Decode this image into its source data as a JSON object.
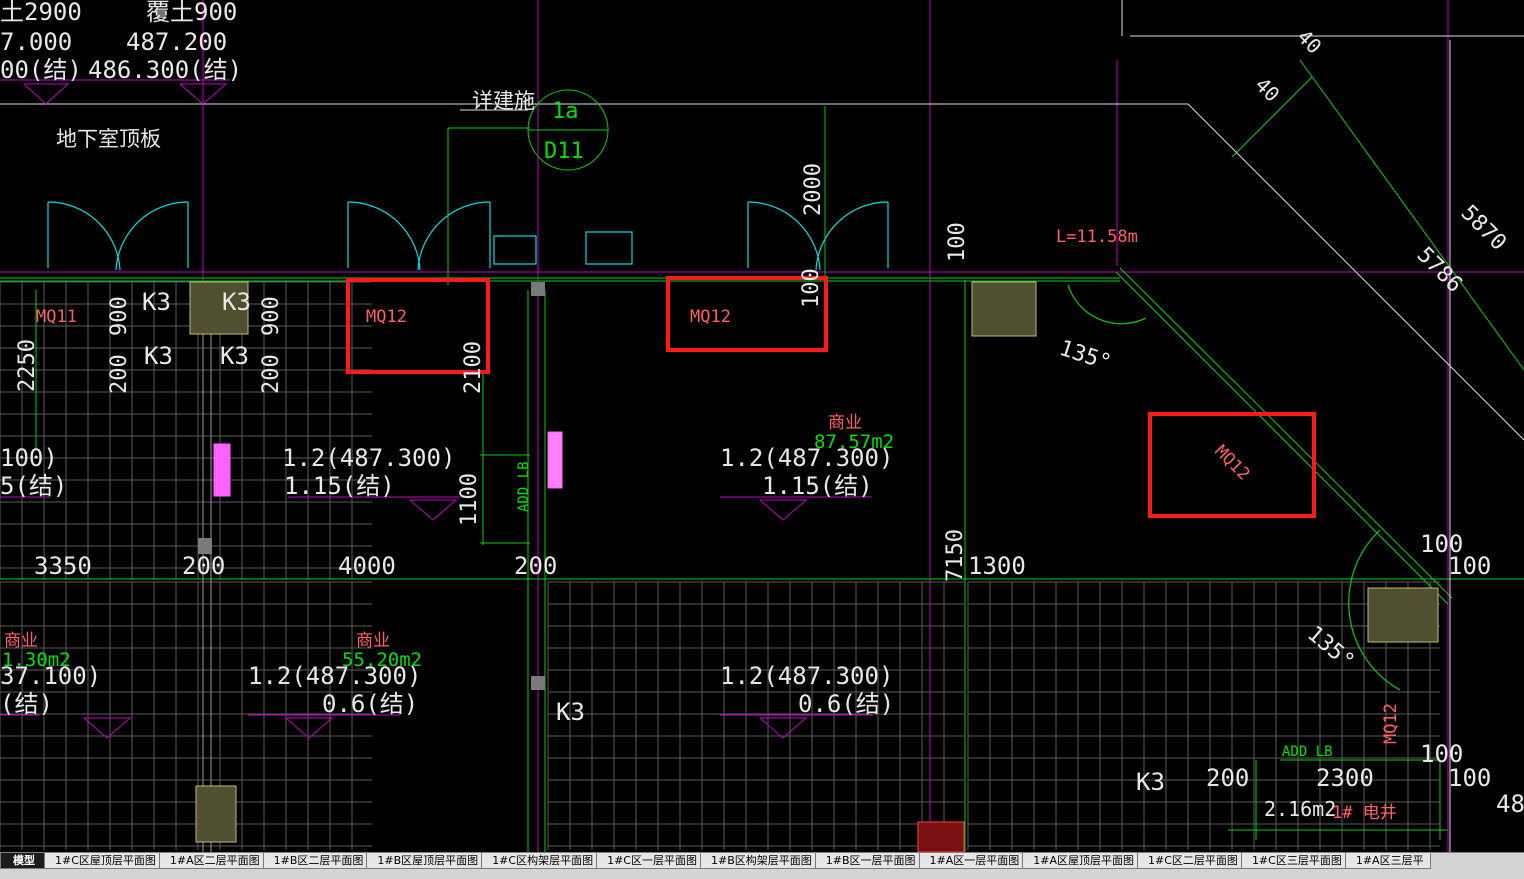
{
  "drawing": {
    "elevations": {
      "top_left_1": "土2900",
      "top_left_2": "7.000",
      "top_left_3": "00(结)",
      "top_mid_1": "覆土900",
      "top_mid_2": "487.200",
      "top_mid_3": "486.300(结)"
    },
    "labels": {
      "basement_roof": "地下室顶板",
      "see_arch": "详建施",
      "detail_num": "1a",
      "detail_sheet": "D11",
      "length": "L=11.58m",
      "angle1": "135°",
      "angle2": "135°",
      "shop_a": "商业",
      "shop_a_area": "87.57m2",
      "shop_b": "商业",
      "shop_b_area": "1.30m2",
      "shop_c": "商业",
      "shop_c_area": "55.20m2",
      "elec_shaft_area": "2.16m2",
      "elec_shaft": "1# 电井",
      "add_lb_1": "ADD LB",
      "add_lb_2": "ADD LB"
    },
    "tags": {
      "mq11": "MQ11",
      "mq12_a": "MQ12",
      "mq12_b": "MQ12",
      "mq12_c": "MQ12",
      "mq12_d": "MQ12",
      "k3_1": "K3",
      "k3_2": "K3",
      "k3_3": "K3",
      "k3_4": "K3",
      "k3_5": "K3",
      "k3_6": "K3"
    },
    "dimensions": {
      "d2000": "2000",
      "d100_a": "100",
      "d100_b": "100",
      "d900_a": "900",
      "d900_b": "900",
      "d200_a": "200",
      "d200_b": "200",
      "d2250": "2250",
      "d2100": "2100",
      "d1100": "1100",
      "d3350": "3350",
      "d200_c": "200",
      "d4000": "4000",
      "d200_d": "200",
      "d7150": "7150",
      "d1300": "1300",
      "d100_c": "100",
      "d100_d": "100",
      "d5870": "5870",
      "d5786": "5786",
      "d40_a": "40",
      "d40_b": "40",
      "d200_e": "200",
      "d2300": "2300",
      "d100_e": "100",
      "d100_f": "100",
      "d48": "48"
    },
    "levels": {
      "lv1": "100)",
      "lv1b": "5(结)",
      "lv2": "1.2(487.300)",
      "lv2b": "1.15(结)",
      "lv3": "1.2(487.300)",
      "lv3b": "1.15(结)",
      "lv4": "37.100)",
      "lv4b": "(结)",
      "lv5": "1.2(487.300)",
      "lv5b": "0.6(结)",
      "lv6": "1.2(487.300)",
      "lv6b": "0.6(结)"
    },
    "colors": {
      "background": "#000000",
      "green": "#00ff00",
      "white": "#ffffff",
      "magenta": "#ff00ff",
      "cyan": "#00ffff",
      "red_box": "#ff1a1a",
      "tag_red": "#ff6060",
      "grey_grid": "#6a6a6a"
    }
  },
  "tabs": [
    "模型",
    "1#C区屋顶层平面图",
    "1#A区二层平面图",
    "1#B区二层平面图",
    "1#B区屋顶层平面图",
    "1#C区构架层平面图",
    "1#C区一层平面图",
    "1#B区构架层平面图",
    "1#B区一层平面图",
    "1#A区一层平面图",
    "1#A区屋顶层平面图",
    "1#C区二层平面图",
    "1#C区三层平面图",
    "1#A区三层平"
  ]
}
